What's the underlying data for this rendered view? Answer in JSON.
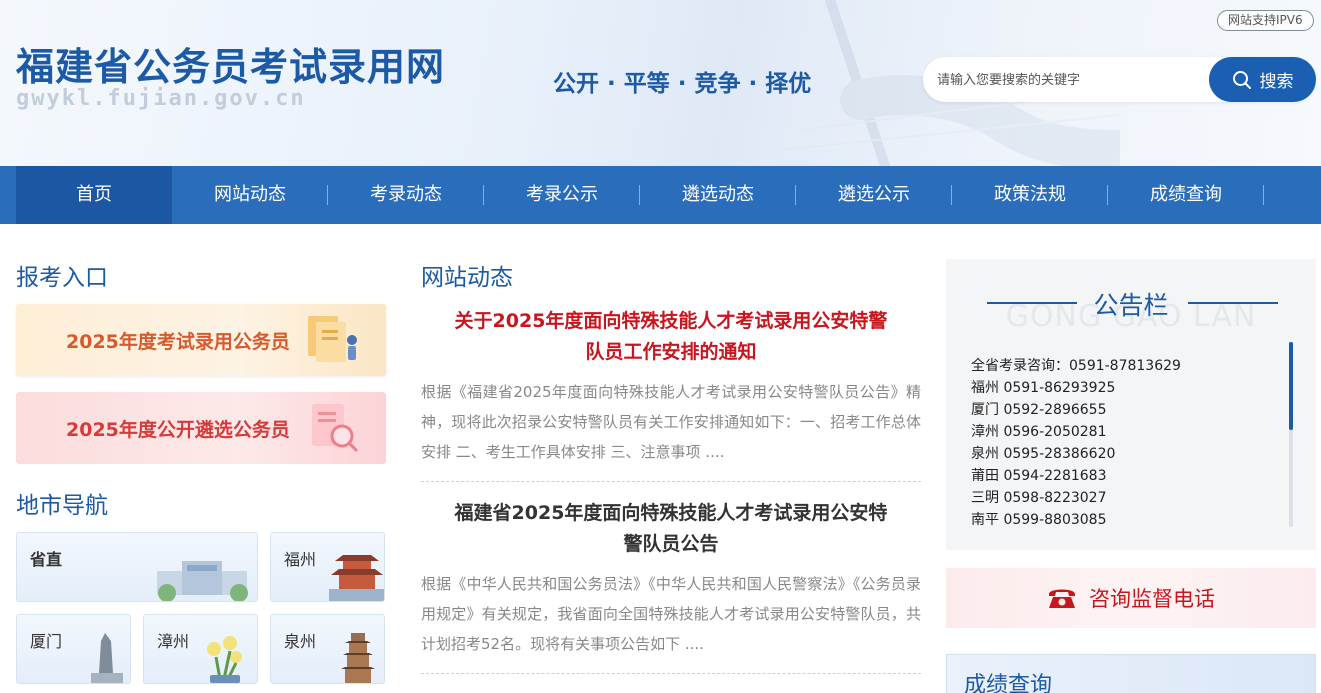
{
  "header": {
    "site_title": "福建省公务员考试录用网",
    "site_domain": "gwykl.fujian.gov.cn",
    "slogan": "公开 · 平等 · 竞争 · 择优",
    "ipv6_badge": "网站支持IPV6",
    "search_placeholder": "请输入您要搜索的关键字",
    "search_button": "搜索"
  },
  "nav": {
    "items": [
      {
        "label": "首页",
        "active": true
      },
      {
        "label": "网站动态"
      },
      {
        "label": "考录动态"
      },
      {
        "label": "考录公示"
      },
      {
        "label": "遴选动态"
      },
      {
        "label": "遴选公示"
      },
      {
        "label": "政策法规"
      },
      {
        "label": "成绩查询"
      }
    ]
  },
  "left": {
    "entry_title": "报考入口",
    "entry_cards": [
      {
        "label": "2025年度考试录用公务员"
      },
      {
        "label": "2025年度公开遴选公务员"
      }
    ],
    "city_title": "地市导航",
    "cities": [
      "省直",
      "福州",
      "厦门",
      "漳州",
      "泉州"
    ]
  },
  "middle": {
    "section_title": "网站动态",
    "news": [
      {
        "title": "关于2025年度面向特殊技能人才考试录用公安特警队员工作安排的通知",
        "summary": "根据《福建省2025年度面向特殊技能人才考试录用公安特警队员公告》精神，现将此次招录公安特警队员有关工作安排通知如下：一、招考工作总体安排 二、考生工作具体安排 三、注意事项 ...."
      },
      {
        "title": "福建省2025年度面向特殊技能人才考试录用公安特警队员公告",
        "summary": "根据《中华人民共和国公务员法》《中华人民共和国人民警察法》《公务员录用规定》有关规定，我省面向全国特殊技能人才考试录用公安特警队员，共计划招考52名。现将有关事项公告如下 ...."
      }
    ]
  },
  "right": {
    "notice_title": "公告栏",
    "notice_en": "GONG GAO LAN",
    "phones": [
      "全省考录咨询：0591-87813629",
      "福州 0591-86293925",
      "厦门 0592-2896655",
      "漳州 0596-2050281",
      "泉州 0595-28386620",
      "莆田 0594-2281683",
      "三明 0598-8223027",
      "南平 0599-8803085"
    ],
    "hotline": "咨询监督电话",
    "score_title": "成绩查询"
  },
  "colors": {
    "brand_blue": "#1c5aa6",
    "nav_blue": "#2a6dbb",
    "headline_red": "#c8161d"
  }
}
